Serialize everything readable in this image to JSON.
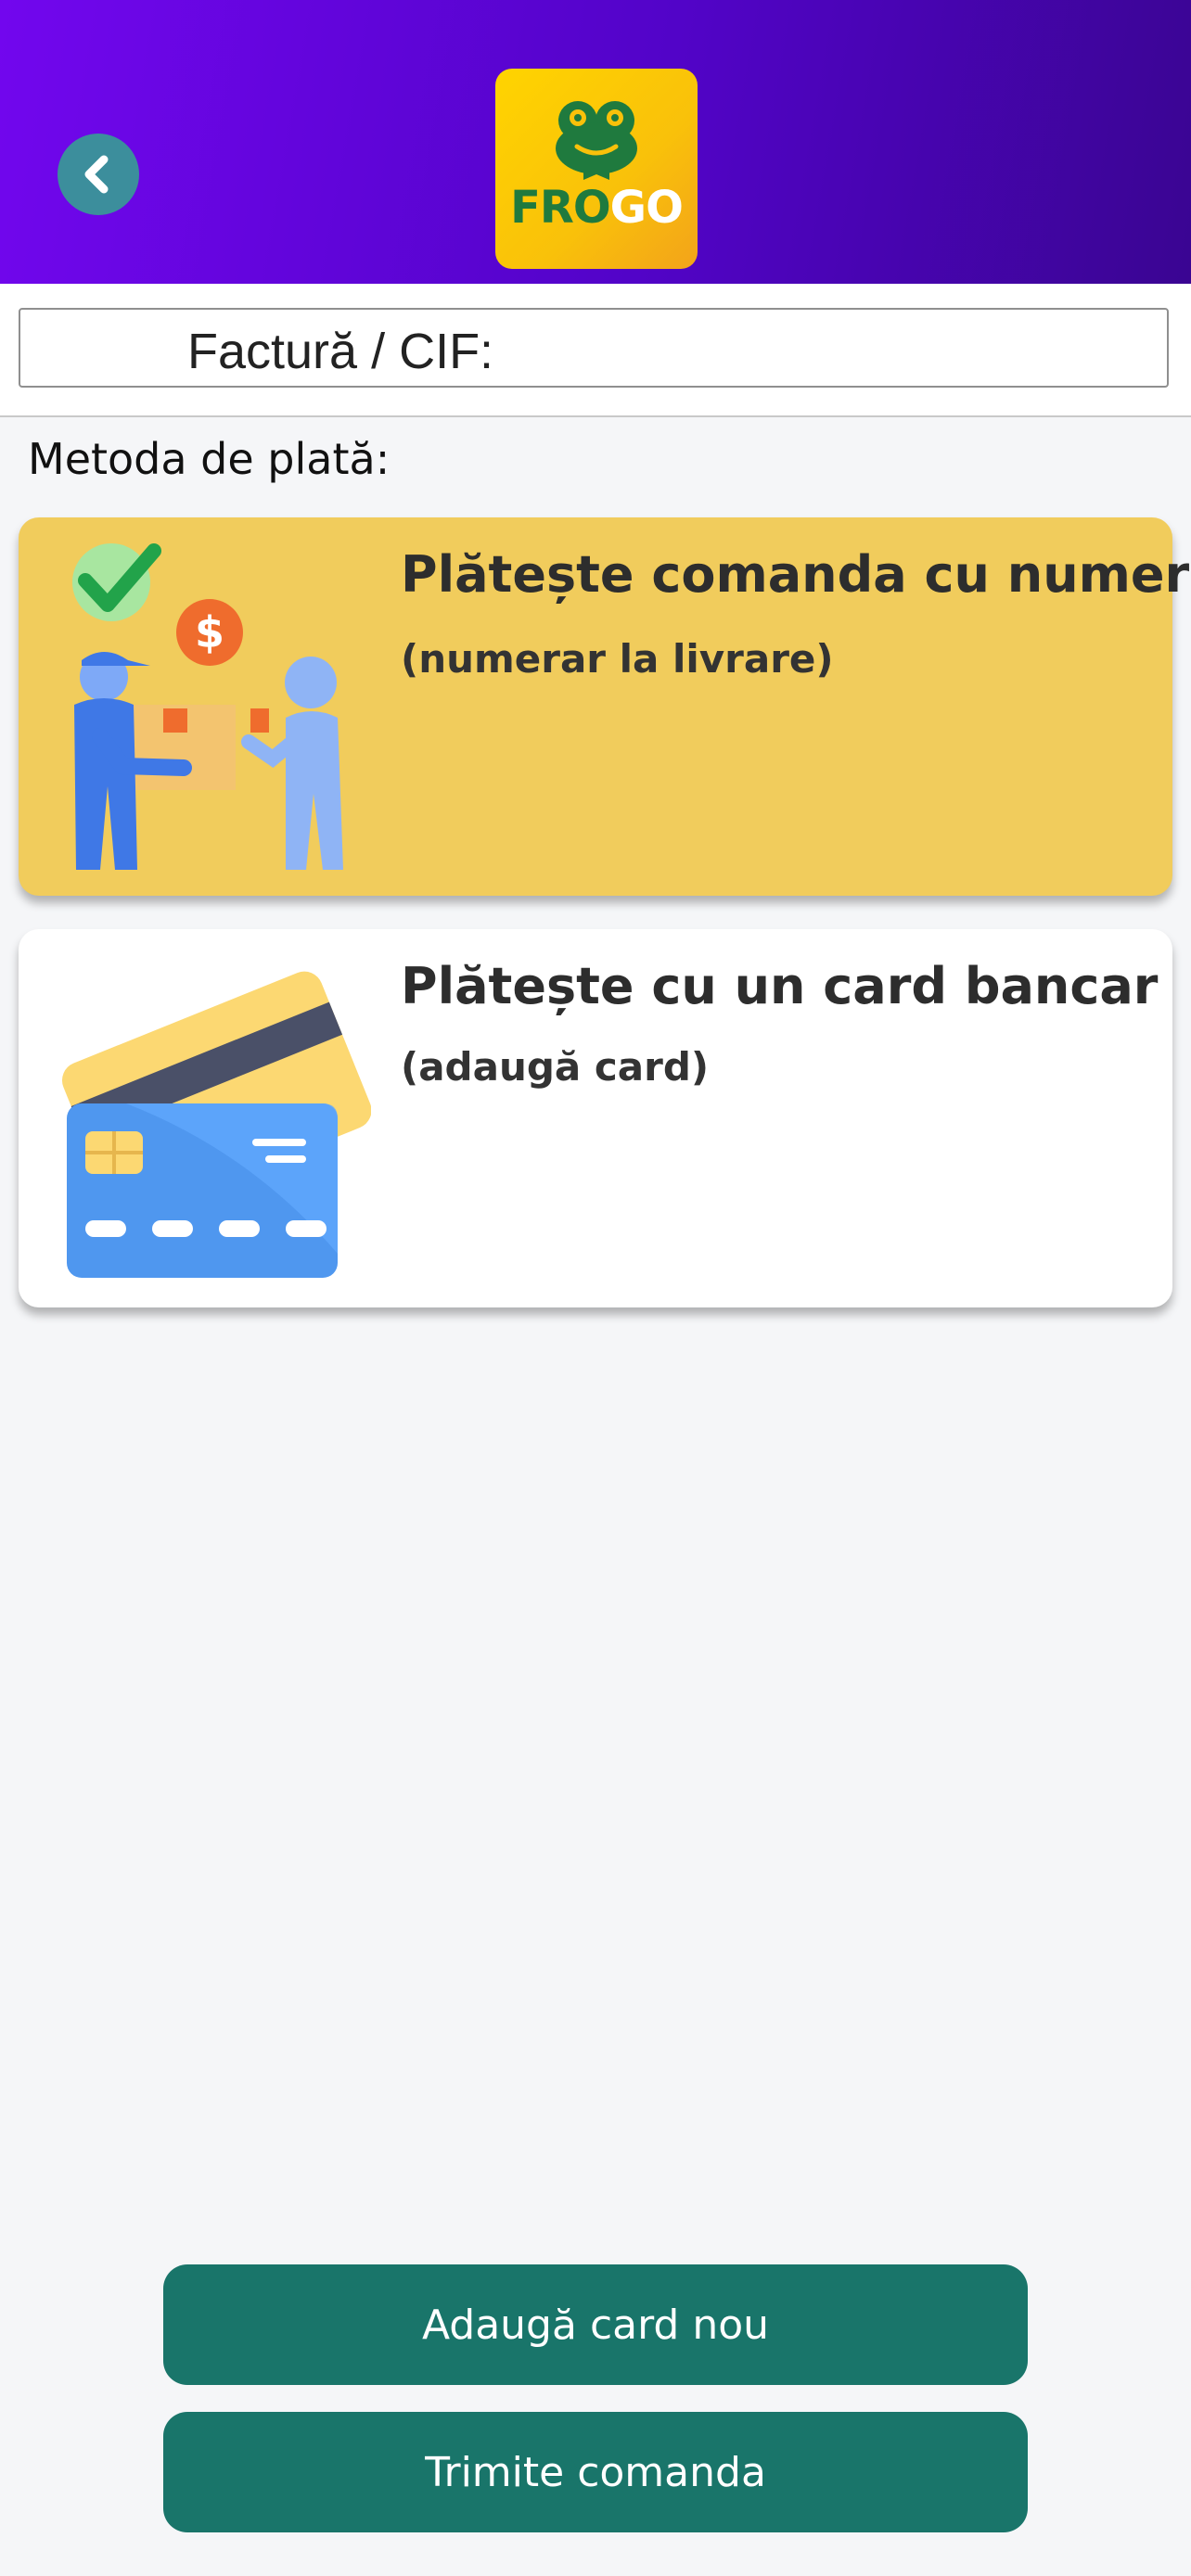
{
  "header": {
    "brand": {
      "part1": "FRO",
      "part2": "GO"
    }
  },
  "invoice": {
    "label": "Factură / CIF:"
  },
  "payment": {
    "section_label": "Metoda de plată:",
    "options": [
      {
        "title": "Plătește comanda cu numerar",
        "subtitle": "(numerar la livrare)",
        "icon": "cash-delivery-illustration"
      },
      {
        "title": "Plătește cu un card bancar",
        "subtitle": "(adaugă card)",
        "icon": "bank-card-illustration"
      }
    ]
  },
  "actions": {
    "add_card_label": "Adaugă card nou",
    "submit_label": "Trimite comanda"
  },
  "colors": {
    "header_start": "#7206ee",
    "header_end": "#3a0592",
    "cash_card_bg": "#f1cc5c",
    "button_bg": "#19756a"
  }
}
